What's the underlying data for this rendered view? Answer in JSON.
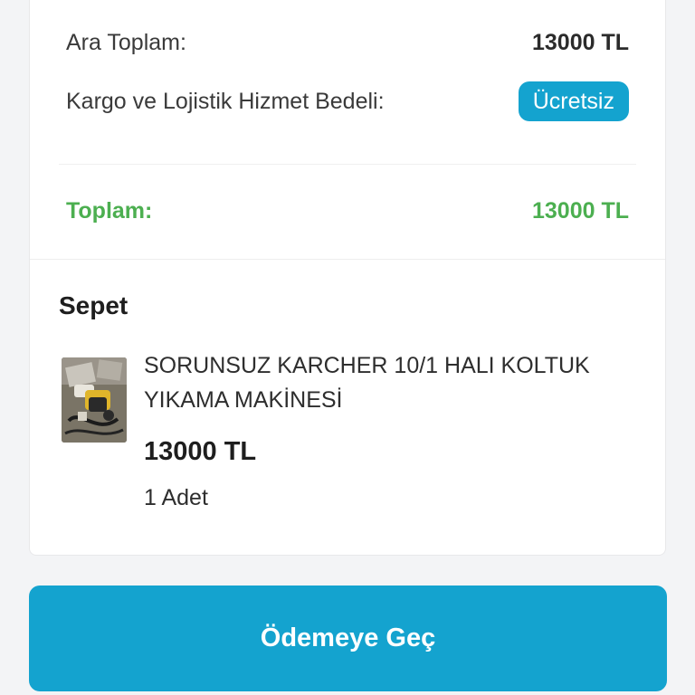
{
  "summary": {
    "subtotal_label": "Ara Toplam:",
    "subtotal_value": "13000 TL",
    "shipping_label": "Kargo ve Lojistik Hizmet Bedeli:",
    "shipping_value": "Ücretsiz",
    "total_label": "Toplam:",
    "total_value": "13000 TL"
  },
  "cart": {
    "title": "Sepet",
    "items": [
      {
        "name": "SORUNSUZ KARCHER 10/1 HALI KOLTUK YIKAMA MAKİNESİ",
        "price": "13000 TL",
        "quantity": "1 Adet",
        "image_icon": "product-photo-icon"
      }
    ]
  },
  "checkout": {
    "button_label": "Ödemeye Geç"
  },
  "colors": {
    "accent": "#14a3cf",
    "total_green": "#4caf50",
    "background": "#f3f4f6",
    "card": "#ffffff"
  }
}
